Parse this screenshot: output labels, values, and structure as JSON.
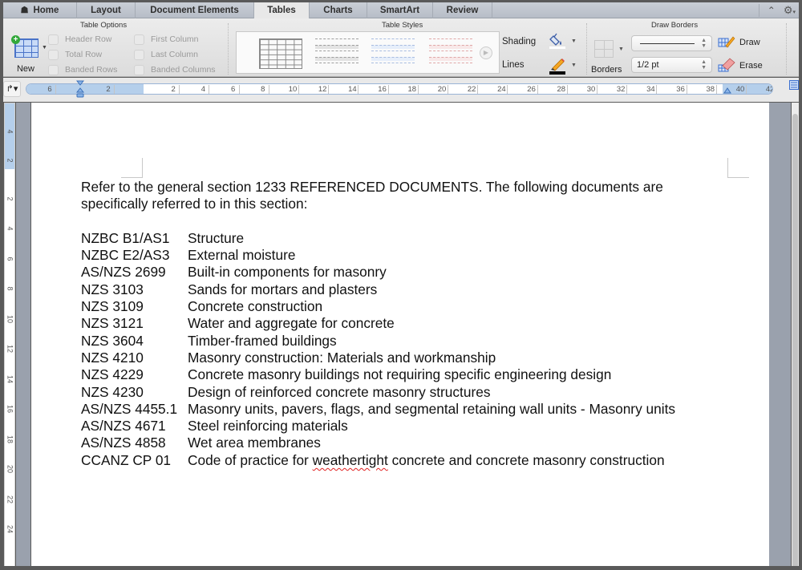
{
  "tabs": [
    {
      "label": "Home",
      "icon": "home-icon"
    },
    {
      "label": "Layout"
    },
    {
      "label": "Document Elements"
    },
    {
      "label": "Tables",
      "active": true
    },
    {
      "label": "Charts"
    },
    {
      "label": "SmartArt"
    },
    {
      "label": "Review"
    }
  ],
  "ribbon": {
    "table_options": {
      "title": "Table Options",
      "new_label": "New",
      "options": [
        {
          "label": "Header Row",
          "checked": false
        },
        {
          "label": "Total Row",
          "checked": false
        },
        {
          "label": "Banded Rows",
          "checked": false
        },
        {
          "label": "First Column",
          "checked": false
        },
        {
          "label": "Last Column",
          "checked": false
        },
        {
          "label": "Banded Columns",
          "checked": false
        }
      ]
    },
    "table_styles": {
      "title": "Table Styles",
      "shading_label": "Shading",
      "lines_label": "Lines",
      "style_colors": [
        "#888888",
        "#9e9e9e",
        "#a8bce0",
        "#e0a8a8"
      ]
    },
    "draw_borders": {
      "title": "Draw Borders",
      "borders_label": "Borders",
      "line_weight": "1/2 pt",
      "draw_label": "Draw",
      "erase_label": "Erase"
    }
  },
  "ruler": {
    "horizontal_ticks": [
      "6",
      "2",
      "2",
      "4",
      "6",
      "8",
      "10",
      "12",
      "14",
      "16",
      "18",
      "20",
      "22",
      "24",
      "26",
      "28",
      "30",
      "32",
      "34",
      "36",
      "38",
      "40",
      "42"
    ],
    "vertical_ticks": [
      "4",
      "2",
      "2",
      "4",
      "6",
      "8",
      "10",
      "12",
      "14",
      "16",
      "18",
      "20",
      "22",
      "24"
    ]
  },
  "document": {
    "intro": "Refer to the general section 1233 REFERENCED DOCUMENTS.  The following documents are specifically referred to in this section:",
    "references": [
      {
        "code": "NZBC B1/AS1",
        "title": "Structure"
      },
      {
        "code": "NZBC E2/AS3",
        "title": "External moisture"
      },
      {
        "code": "AS/NZS 2699",
        "title": "Built-in components for masonry"
      },
      {
        "code": "NZS 3103",
        "title": "Sands for mortars and plasters"
      },
      {
        "code": "NZS 3109",
        "title": "Concrete construction"
      },
      {
        "code": "NZS 3121",
        "title": "Water and aggregate for concrete"
      },
      {
        "code": "NZS 3604",
        "title": "Timber-framed buildings"
      },
      {
        "code": "NZS 4210",
        "title": "Masonry construction: Materials and workmanship"
      },
      {
        "code": "NZS 4229",
        "title": "Concrete masonry buildings not requiring specific engineering design"
      },
      {
        "code": "NZS 4230",
        "title": "Design of reinforced concrete masonry structures"
      },
      {
        "code": "AS/NZS 4455.1",
        "title": "Masonry units, pavers, flags, and segmental retaining wall units - Masonry units"
      },
      {
        "code": "AS/NZS 4671",
        "title": "Steel reinforcing materials"
      },
      {
        "code": "AS/NZS 4858",
        "title": "Wet area membranes"
      },
      {
        "code": "CCANZ CP 01",
        "title_before": "Code of practice for ",
        "title_misspelled": "weathertight",
        "title_after": " concrete and concrete masonry construction"
      }
    ]
  }
}
